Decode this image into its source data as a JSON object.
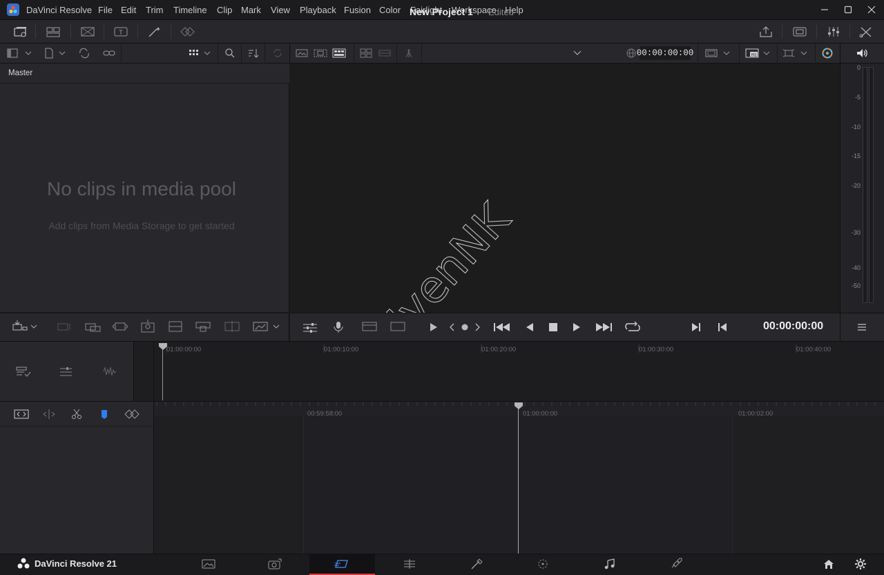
{
  "app": {
    "title": "DaVinci Resolve",
    "bottom_name": "DaVinci Resolve 21"
  },
  "menu": [
    "File",
    "Edit",
    "Trim",
    "Timeline",
    "Clip",
    "Mark",
    "View",
    "Playback",
    "Fusion",
    "Color",
    "Fairlight",
    "Workspace",
    "Help"
  ],
  "project": {
    "name": "New Project 1",
    "status": "Edited"
  },
  "media_pool": {
    "bin_label": "Master",
    "empty_title": "No clips in media pool",
    "empty_subtitle": "Add clips from Media Storage to get started"
  },
  "viewer": {
    "timecode_top": "00:00:00:00",
    "timecode_main": "00:00:00:00",
    "watermark": "UyenNK"
  },
  "audio_meter": {
    "scale": [
      "0",
      "-5",
      "-10",
      "-15",
      "-20",
      "-30",
      "-40",
      "-50"
    ]
  },
  "upper_timeline": {
    "ruler": [
      "01:00:00:00",
      "01:00:10:00",
      "01:00:20:00",
      "01:00:30:00",
      "01:00:40:00"
    ]
  },
  "lower_timeline": {
    "ruler": [
      "00:59:58:00",
      "01:00:00:00",
      "01:00:02:00"
    ]
  },
  "pages": [
    "media",
    "cut",
    "edit",
    "fusion",
    "color",
    "fairlight",
    "deliver"
  ],
  "active_page": "cut",
  "colors": {
    "accent_red": "#e0383f",
    "marker_blue": "#2f7df2"
  }
}
